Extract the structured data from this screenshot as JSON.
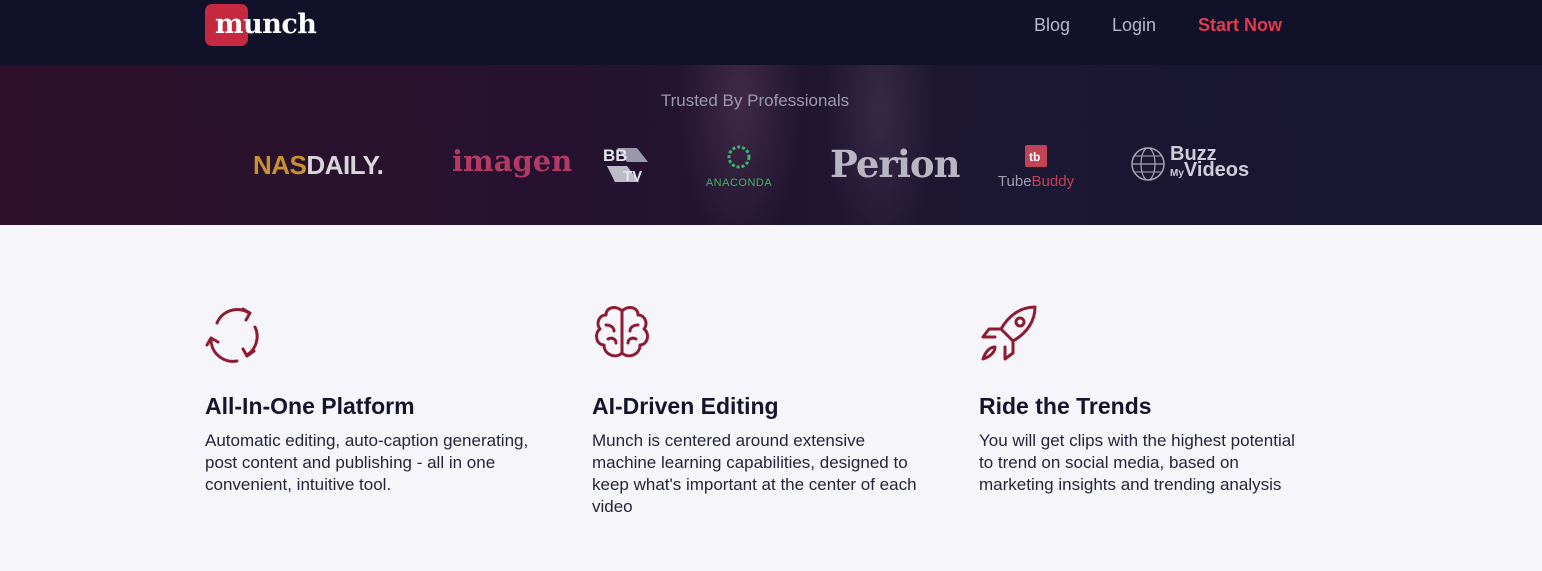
{
  "navbar": {
    "logo_text": "munch",
    "links": [
      {
        "label": "Blog"
      },
      {
        "label": "Login"
      },
      {
        "label": "Start Now"
      }
    ]
  },
  "trusted": {
    "heading": "Trusted By Professionals",
    "logos": [
      {
        "name": "nasdaily",
        "text_a": "NAS",
        "text_b": "DAILY."
      },
      {
        "name": "imagen",
        "text": "imagen"
      },
      {
        "name": "bbtv",
        "text_a": "BB",
        "text_b": "TV"
      },
      {
        "name": "anaconda",
        "text": "ANACONDA"
      },
      {
        "name": "perion",
        "text": "Perion"
      },
      {
        "name": "tubebuddy",
        "text_a": "Tube",
        "text_b": "Buddy",
        "icon_text": "tb"
      },
      {
        "name": "buzzmyvideos",
        "text_a": "Buzz",
        "text_my": "My",
        "text_b": "Videos"
      }
    ]
  },
  "features": [
    {
      "icon": "refresh-cycle-icon",
      "title": "All-In-One Platform",
      "description": "Automatic editing, auto-caption generating, post content and publishing - all in one convenient, intuitive tool."
    },
    {
      "icon": "brain-icon",
      "title": "AI-Driven Editing",
      "description": "Munch is centered around extensive machine learning capabilities, designed to keep what's important at the center of each video"
    },
    {
      "icon": "rocket-icon",
      "title": "Ride the Trends",
      "description": "You will get clips with the highest potential to trend on social media, based on marketing insights and trending analysis"
    }
  ],
  "colors": {
    "accent": "#c5283f",
    "icon": "#8c1d33",
    "nav_bg": "#11122a",
    "page_bg": "#f6f5fa"
  }
}
